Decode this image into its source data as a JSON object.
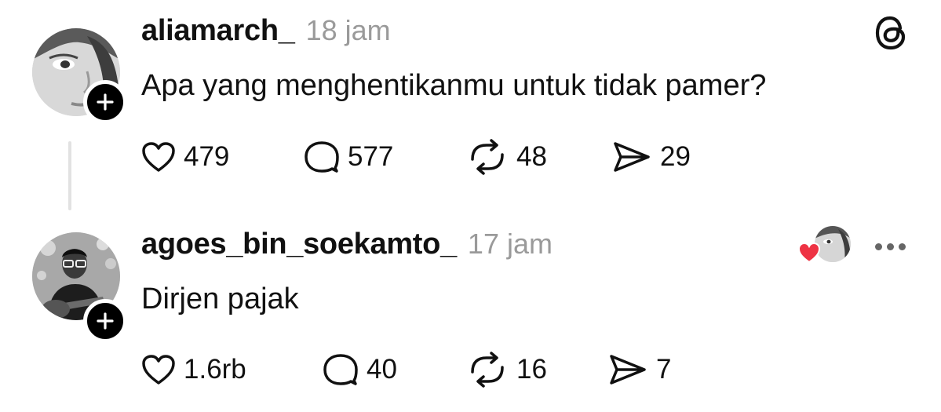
{
  "colors": {
    "like_red": "#ee3344",
    "muted": "#9a9a9a",
    "text": "#111111"
  },
  "posts": [
    {
      "username": "aliamarch_",
      "time": "18 jam",
      "text": "Apa yang menghentikanmu untuk tidak pamer?",
      "likes": "479",
      "comments": "577",
      "reposts": "48",
      "shares": "29"
    },
    {
      "username": "agoes_bin_soekamto_",
      "time": "17 jam",
      "text": "Dirjen pajak",
      "likes": "1.6rb",
      "comments": "40",
      "reposts": "16",
      "shares": "7"
    }
  ],
  "icons": {
    "app_logo": "threads-logo-icon",
    "like": "heart-icon",
    "comment": "comment-bubble-icon",
    "repost": "repost-icon",
    "share": "send-icon",
    "more": "more-options-icon",
    "follow": "plus-icon"
  }
}
